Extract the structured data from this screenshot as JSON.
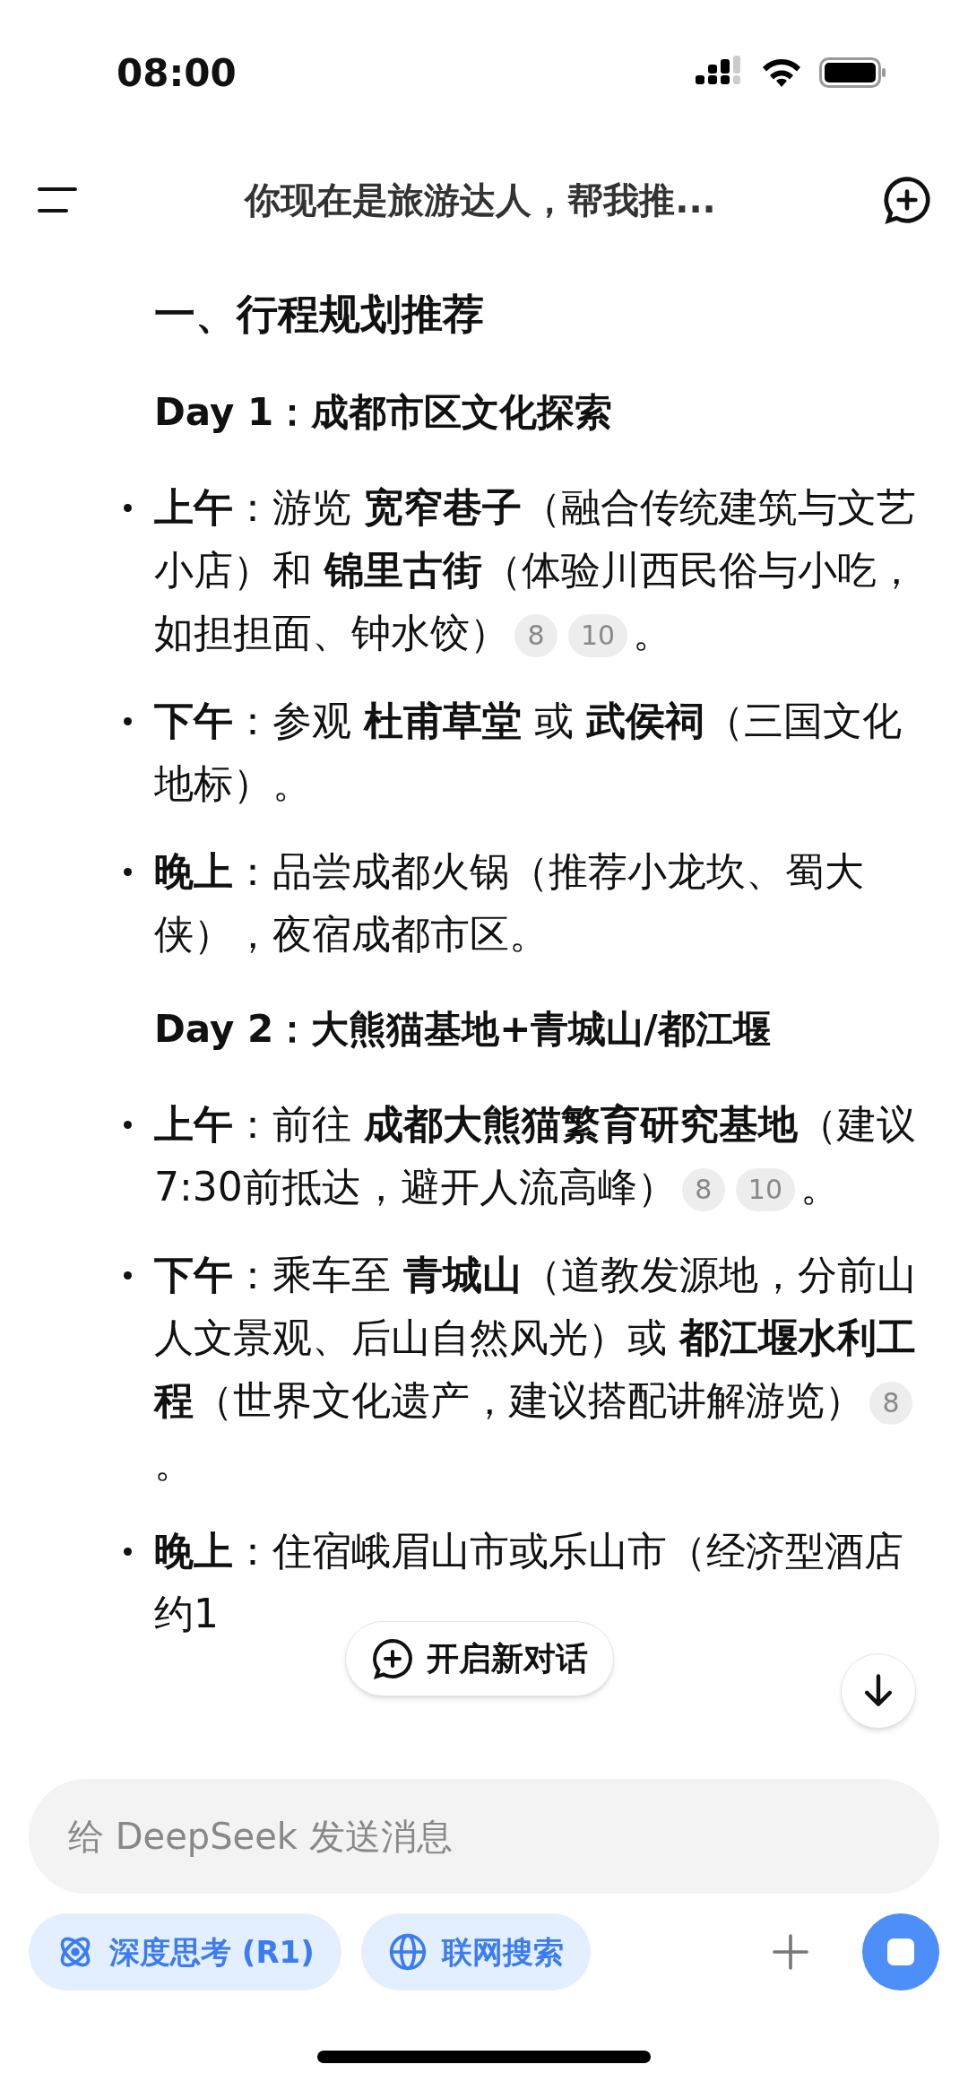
{
  "status_bar": {
    "time": "08:00"
  },
  "header": {
    "title": "你现在是旅游达人，帮我推..."
  },
  "content": {
    "heading": "一、行程规划推荐",
    "days": [
      {
        "title": "Day 1：成都市区文化探索",
        "items": [
          {
            "segments": [
              {
                "kind": "text",
                "text": "**上午**：游览 **宽窄巷子**（融合传统建筑与文艺小店）和 **锦里古街**（体验川西民俗与小吃，如担担面、钟水饺）"
              },
              {
                "kind": "cite",
                "text": "8"
              },
              {
                "kind": "cite",
                "text": "10"
              },
              {
                "kind": "text",
                "text": "。"
              }
            ]
          },
          {
            "segments": [
              {
                "kind": "text",
                "text": "**下午**：参观 **杜甫草堂** 或 **武侯祠**（三国文化地标）。"
              }
            ]
          },
          {
            "segments": [
              {
                "kind": "text",
                "text": "**晚上**：品尝成都火锅（推荐小龙坎、蜀大侠），夜宿成都市区。"
              }
            ]
          }
        ]
      },
      {
        "title": "Day 2：大熊猫基地+青城山/都江堰",
        "items": [
          {
            "segments": [
              {
                "kind": "text",
                "text": "**上午**：前往 **成都大熊猫繁育研究基地**（建议7:30前抵达，避开人流高峰）"
              },
              {
                "kind": "cite",
                "text": "8"
              },
              {
                "kind": "cite",
                "text": "10"
              },
              {
                "kind": "text",
                "text": "。"
              }
            ]
          },
          {
            "segments": [
              {
                "kind": "text",
                "text": "**下午**：乘车至 **青城山**（道教发源地，分前山人文景观、后山自然风光）或 **都江堰水利工程**（世界文化遗产，建议搭配讲解游览）"
              },
              {
                "kind": "cite",
                "text": "8"
              },
              {
                "kind": "text",
                "text": "。"
              }
            ]
          },
          {
            "segments": [
              {
                "kind": "text",
                "text": "**晚上**：住宿峨眉山市或乐山市（经济型酒店约1"
              }
            ]
          }
        ]
      }
    ]
  },
  "new_chat_button": {
    "label": "开启新对话"
  },
  "composer": {
    "placeholder": "给 DeepSeek 发送消息",
    "toggles": [
      {
        "kind": "think",
        "label": "深度思考 (R1)",
        "selected": true
      },
      {
        "kind": "search",
        "label": "联网搜索",
        "selected": true
      }
    ]
  }
}
